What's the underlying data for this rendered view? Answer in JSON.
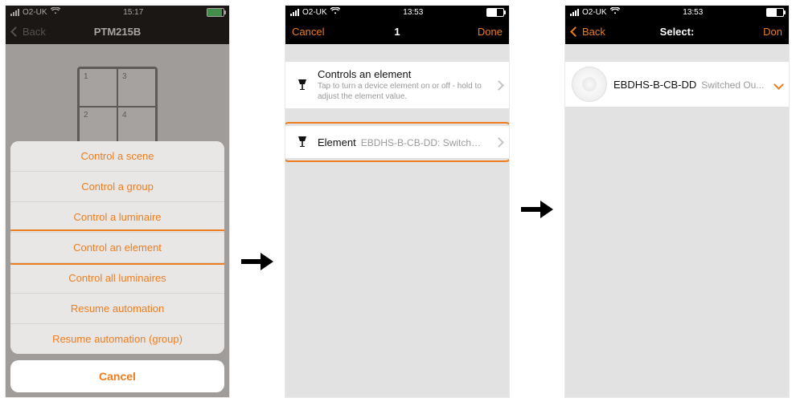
{
  "screen1": {
    "statusbar": {
      "carrier": "O2-UK",
      "time": "15:17",
      "wifi": "􀙇",
      "battery_pct": 92,
      "battery_color": "#4cd964"
    },
    "nav": {
      "back": "Back",
      "title": "PTM215B"
    },
    "switch_buttons": [
      "1",
      "3",
      "2",
      "4"
    ],
    "sheet": {
      "options": [
        "Control a scene",
        "Control a group",
        "Control a luminaire",
        "Control an element",
        "Control all luminaires",
        "Resume automation",
        "Resume automation (group)"
      ],
      "cancel": "Cancel",
      "highlight_index": 3
    }
  },
  "screen2": {
    "statusbar": {
      "carrier": "O2-UK",
      "time": "13:53",
      "wifi": "􀙇"
    },
    "nav": {
      "left": "Cancel",
      "title": "1",
      "right": "Done"
    },
    "info": {
      "title": "Controls an element",
      "sub": "Tap to turn a device element on or off - hold to adjust the element value."
    },
    "element_row": {
      "label": "Element",
      "value": "EBDHS-B-CB-DD: Switched O..."
    }
  },
  "screen3": {
    "statusbar": {
      "carrier": "O2-UK",
      "time": "13:53",
      "wifi": "􀙇"
    },
    "nav": {
      "back": "Back",
      "title": "Select:",
      "right": "Don"
    },
    "item": {
      "name": "EBDHS-B-CB-DD",
      "sub": "Switched Ou..."
    }
  },
  "icons": {
    "lamp": "lamp-icon",
    "sensor": "motion-sensor-icon"
  }
}
